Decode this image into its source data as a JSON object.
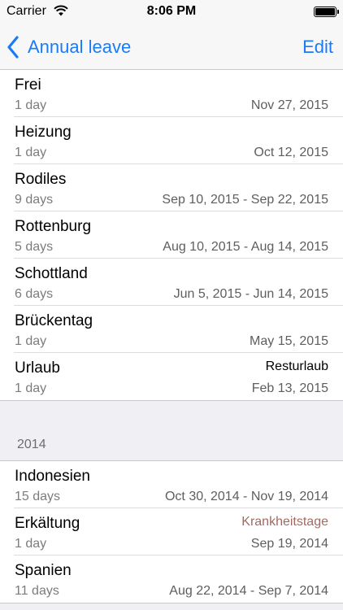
{
  "status": {
    "carrier": "Carrier",
    "time": "8:06 PM"
  },
  "nav": {
    "back_label": "Annual leave",
    "edit_label": "Edit"
  },
  "sections": [
    {
      "title": "",
      "rows": [
        {
          "title": "Frei",
          "days": "1 day",
          "category": "",
          "date": "Nov 27, 2015"
        },
        {
          "title": "Heizung",
          "days": "1 day",
          "category": "",
          "date": "Oct 12, 2015"
        },
        {
          "title": "Rodiles",
          "days": "9 days",
          "category": "",
          "date": "Sep 10, 2015 - Sep 22, 2015"
        },
        {
          "title": "Rottenburg",
          "days": "5 days",
          "category": "",
          "date": "Aug 10, 2015 - Aug 14, 2015"
        },
        {
          "title": "Schottland",
          "days": "6 days",
          "category": "",
          "date": "Jun 5, 2015 - Jun 14, 2015"
        },
        {
          "title": "Brückentag",
          "days": "1 day",
          "category": "",
          "date": "May 15, 2015"
        },
        {
          "title": "Urlaub",
          "days": "1 day",
          "category": "Resturlaub",
          "date": "Feb 13, 2015"
        }
      ]
    },
    {
      "title": "2014",
      "rows": [
        {
          "title": "Indonesien",
          "days": "15 days",
          "category": "",
          "date": "Oct 30, 2014 - Nov 19, 2014"
        },
        {
          "title": "Erkältung",
          "days": "1 day",
          "category": "Krankheitstage",
          "date": "Sep 19, 2014"
        },
        {
          "title": "Spanien",
          "days": "11 days",
          "category": "",
          "date": "Aug 22, 2014 - Sep 7, 2014"
        }
      ]
    }
  ],
  "colors": {
    "accent": "#1a7cf5",
    "sick_category": "#a26a61",
    "background": "#efeff4"
  },
  "icons": {
    "back": "chevron-left-icon",
    "wifi": "wifi-icon",
    "battery": "battery-icon"
  }
}
